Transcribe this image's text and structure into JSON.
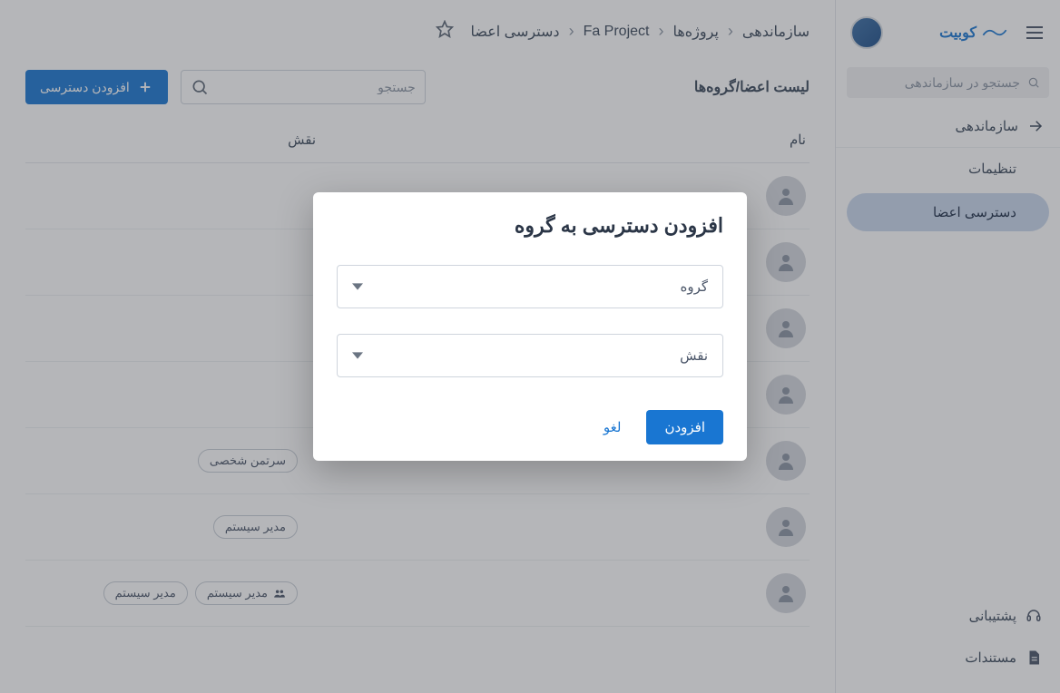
{
  "brand": {
    "name": "کوبیت"
  },
  "sidebar": {
    "search_placeholder": "جستجو در سازماندهی",
    "nav_organization": "سازماندهی",
    "nav_settings": "تنظیمات",
    "nav_access": "دسترسی اعضا",
    "support": "پشتیبانی",
    "docs": "مستندات"
  },
  "breadcrumb": {
    "org": "سازماندهی",
    "projects": "پروژه‌ها",
    "project": "Fa Project",
    "current": "دسترسی اعضا"
  },
  "list": {
    "title": "لیست اعضا/گروه‌ها",
    "search_placeholder": "جستجو",
    "add_label": "افزودن دسترسی",
    "col_name": "نام",
    "col_role": "نقش",
    "rows": [
      {
        "roles": []
      },
      {
        "roles": []
      },
      {
        "roles": []
      },
      {
        "roles": []
      },
      {
        "roles": [
          {
            "label": "سرتمن شخصی",
            "icon": false
          }
        ]
      },
      {
        "roles": [
          {
            "label": "مدیر سیستم",
            "icon": false
          }
        ]
      },
      {
        "roles": [
          {
            "label": "مدیر سیستم",
            "icon": true
          },
          {
            "label": "مدیر سیستم",
            "icon": false
          }
        ]
      }
    ]
  },
  "dialog": {
    "title": "افزودن دسترسی به گروه",
    "group_label": "گروه",
    "role_label": "نقش",
    "submit": "افزودن",
    "cancel": "لغو"
  }
}
